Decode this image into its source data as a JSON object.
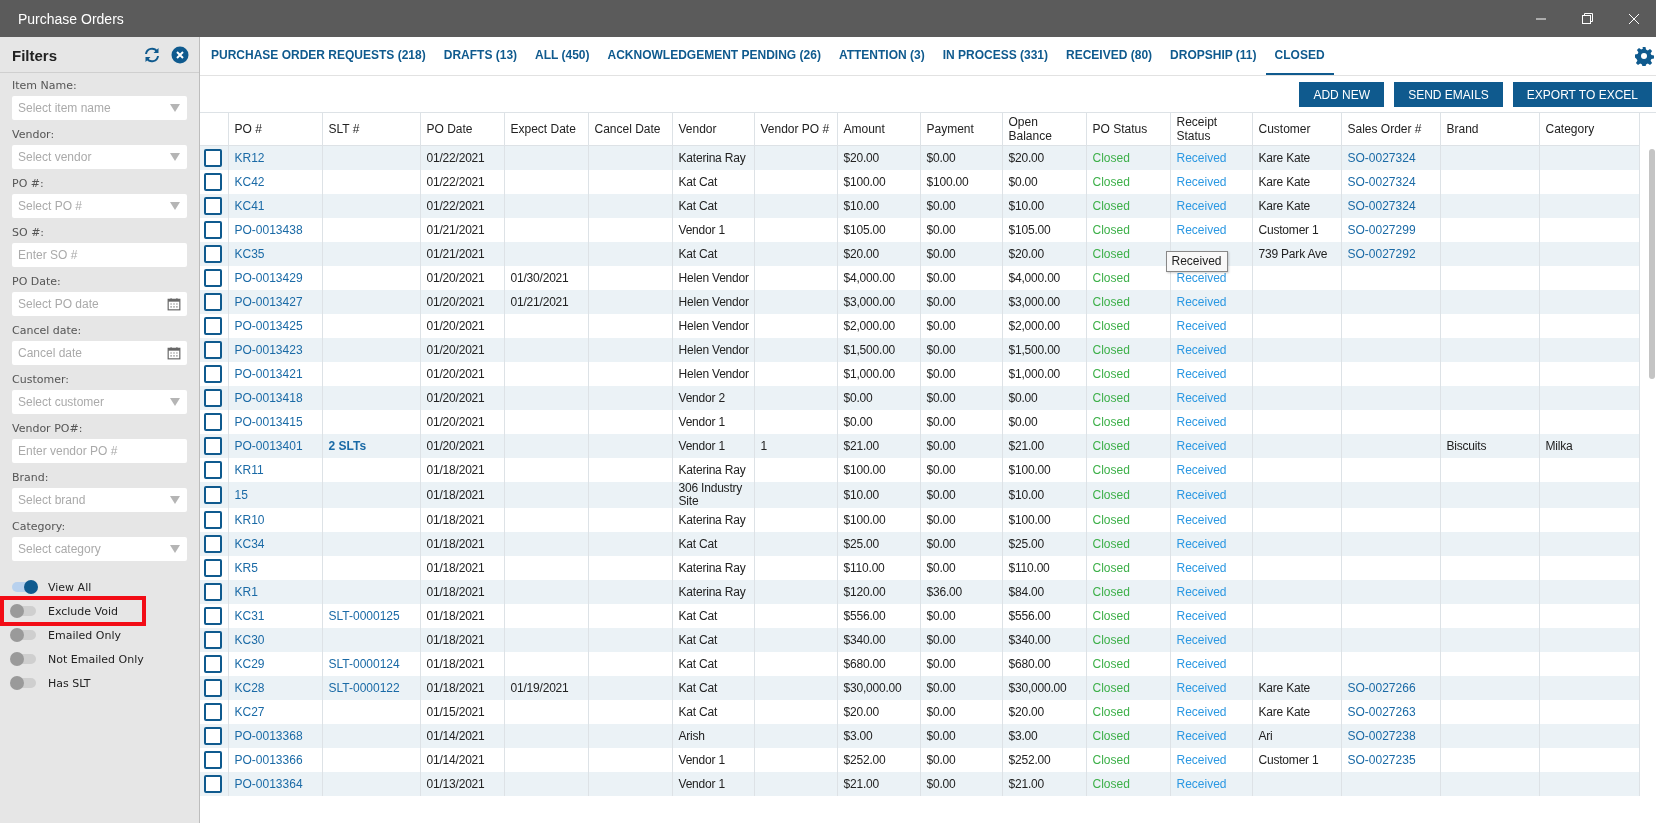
{
  "window": {
    "title": "Purchase Orders"
  },
  "filters": {
    "title": "Filters",
    "fields": [
      {
        "label": "Item Name:",
        "kind": "select",
        "placeholder": "Select item name"
      },
      {
        "label": "Vendor:",
        "kind": "select",
        "placeholder": "Select vendor"
      },
      {
        "label": "PO #:",
        "kind": "select",
        "placeholder": "Select PO #"
      },
      {
        "label": "SO #:",
        "kind": "text",
        "placeholder": "Enter SO #"
      },
      {
        "label": "PO Date:",
        "kind": "date",
        "placeholder": "Select PO date"
      },
      {
        "label": "Cancel date:",
        "kind": "date",
        "placeholder": "Cancel date"
      },
      {
        "label": "Customer:",
        "kind": "select",
        "placeholder": "Select customer"
      },
      {
        "label": "Vendor PO#:",
        "kind": "text",
        "placeholder": "Enter vendor PO #"
      },
      {
        "label": "Brand:",
        "kind": "select",
        "placeholder": "Select brand"
      },
      {
        "label": "Category:",
        "kind": "select",
        "placeholder": "Select category"
      }
    ],
    "toggles": [
      {
        "label": "View All",
        "on": true,
        "highlighted": false
      },
      {
        "label": "Exclude Void",
        "on": false,
        "highlighted": true
      },
      {
        "label": "Emailed Only",
        "on": false,
        "highlighted": false
      },
      {
        "label": "Not Emailed Only",
        "on": false,
        "highlighted": false
      },
      {
        "label": "Has SLT",
        "on": false,
        "highlighted": false
      }
    ]
  },
  "tabs": [
    {
      "label": "PURCHASE ORDER REQUESTS (218)",
      "selected": false
    },
    {
      "label": "DRAFTS (13)",
      "selected": false
    },
    {
      "label": "ALL (450)",
      "selected": false
    },
    {
      "label": "ACKNOWLEDGEMENT PENDING (26)",
      "selected": false
    },
    {
      "label": "ATTENTION (3)",
      "selected": false
    },
    {
      "label": "IN PROCESS (331)",
      "selected": false
    },
    {
      "label": "RECEIVED (80)",
      "selected": false
    },
    {
      "label": "DROPSHIP (11)",
      "selected": false
    },
    {
      "label": "CLOSED",
      "selected": true
    }
  ],
  "buttons": [
    "ADD NEW",
    "SEND EMAILS",
    "EXPORT TO EXCEL"
  ],
  "table": {
    "columns": [
      {
        "label": "PO #",
        "kind": "link"
      },
      {
        "label": "SLT #",
        "kind": "link"
      },
      {
        "label": "PO Date",
        "kind": "text"
      },
      {
        "label": "Expect Date",
        "kind": "text"
      },
      {
        "label": "Cancel Date",
        "kind": "text"
      },
      {
        "label": "Vendor",
        "kind": "text"
      },
      {
        "label": "Vendor PO #",
        "kind": "text"
      },
      {
        "label": "Amount",
        "kind": "text"
      },
      {
        "label": "Payment",
        "kind": "text"
      },
      {
        "label": "Open Balance",
        "kind": "text"
      },
      {
        "label": "PO Status",
        "kind": "status"
      },
      {
        "label": "Receipt Status",
        "kind": "receipt"
      },
      {
        "label": "Customer",
        "kind": "text"
      },
      {
        "label": "Sales Order #",
        "kind": "link"
      },
      {
        "label": "Brand",
        "kind": "text"
      },
      {
        "label": "Category",
        "kind": "text"
      }
    ],
    "rows": [
      {
        "checked": false,
        "po": "KR12",
        "po_date": "01/22/2021",
        "vendor": "Katerina Ray",
        "amount": "$20.00",
        "payment": "$0.00",
        "open_balance": "$20.00",
        "po_status": "Closed",
        "receipt_status": "Received",
        "customer": "Kare Kate",
        "sales_order": "SO-0027324"
      },
      {
        "checked": false,
        "po": "KC42",
        "po_date": "01/22/2021",
        "vendor": "Kat Cat",
        "amount": "$100.00",
        "payment": "$100.00",
        "open_balance": "$0.00",
        "po_status": "Closed",
        "receipt_status": "Received",
        "customer": "Kare Kate",
        "sales_order": "SO-0027324"
      },
      {
        "checked": false,
        "po": "KC41",
        "po_date": "01/22/2021",
        "vendor": "Kat Cat",
        "amount": "$10.00",
        "payment": "$0.00",
        "open_balance": "$10.00",
        "po_status": "Closed",
        "receipt_status": "Received",
        "customer": "Kare Kate",
        "sales_order": "SO-0027324"
      },
      {
        "checked": false,
        "po": "PO-0013438",
        "po_date": "01/21/2021",
        "vendor": "Vendor 1",
        "amount": "$105.00",
        "payment": "$0.00",
        "open_balance": "$105.00",
        "po_status": "Closed",
        "receipt_status": "Received",
        "customer": "Customer 1",
        "sales_order": "SO-0027299"
      },
      {
        "checked": false,
        "po": "KC35",
        "po_date": "01/21/2021",
        "vendor": "Kat Cat",
        "amount": "$20.00",
        "payment": "$0.00",
        "open_balance": "$20.00",
        "po_status": "Closed",
        "tooltip": "Received",
        "customer": "739 Park Ave",
        "sales_order": "SO-0027292"
      },
      {
        "checked": false,
        "po": "PO-0013429",
        "po_date": "01/20/2021",
        "expect_date": "01/30/2021",
        "vendor": "Helen Vendor",
        "amount": "$4,000.00",
        "payment": "$0.00",
        "open_balance": "$4,000.00",
        "po_status": "Closed",
        "receipt_status": "Received"
      },
      {
        "checked": false,
        "po": "PO-0013427",
        "po_date": "01/20/2021",
        "expect_date": "01/21/2021",
        "vendor": "Helen Vendor",
        "amount": "$3,000.00",
        "payment": "$0.00",
        "open_balance": "$3,000.00",
        "po_status": "Closed",
        "receipt_status": "Received"
      },
      {
        "checked": false,
        "po": "PO-0013425",
        "po_date": "01/20/2021",
        "vendor": "Helen Vendor",
        "amount": "$2,000.00",
        "payment": "$0.00",
        "open_balance": "$2,000.00",
        "po_status": "Closed",
        "receipt_status": "Received"
      },
      {
        "checked": false,
        "po": "PO-0013423",
        "po_date": "01/20/2021",
        "vendor": "Helen Vendor",
        "amount": "$1,500.00",
        "payment": "$0.00",
        "open_balance": "$1,500.00",
        "po_status": "Closed",
        "receipt_status": "Received"
      },
      {
        "checked": false,
        "po": "PO-0013421",
        "po_date": "01/20/2021",
        "vendor": "Helen Vendor",
        "amount": "$1,000.00",
        "payment": "$0.00",
        "open_balance": "$1,000.00",
        "po_status": "Closed",
        "receipt_status": "Received"
      },
      {
        "checked": false,
        "po": "PO-0013418",
        "po_date": "01/20/2021",
        "vendor": "Vendor 2",
        "amount": "$0.00",
        "payment": "$0.00",
        "open_balance": "$0.00",
        "po_status": "Closed",
        "receipt_status": "Received"
      },
      {
        "checked": false,
        "po": "PO-0013415",
        "po_date": "01/20/2021",
        "vendor": "Vendor 1",
        "amount": "$0.00",
        "payment": "$0.00",
        "open_balance": "$0.00",
        "po_status": "Closed",
        "receipt_status": "Received"
      },
      {
        "checked": false,
        "po": "PO-0013401",
        "slt": "2 SLTs",
        "slt_summary": true,
        "po_date": "01/20/2021",
        "vendor": "Vendor 1",
        "vendor_po": "1",
        "amount": "$21.00",
        "payment": "$0.00",
        "open_balance": "$21.00",
        "po_status": "Closed",
        "receipt_status": "Received",
        "brand": "Biscuits",
        "category": "Milka"
      },
      {
        "checked": false,
        "po": "KR11",
        "po_date": "01/18/2021",
        "vendor": "Katerina Ray",
        "amount": "$100.00",
        "payment": "$0.00",
        "open_balance": "$100.00",
        "po_status": "Closed",
        "receipt_status": "Received"
      },
      {
        "checked": false,
        "po": "15",
        "po_date": "01/18/2021",
        "vendor": "306 Industry Site",
        "amount": "$10.00",
        "payment": "$0.00",
        "open_balance": "$10.00",
        "po_status": "Closed",
        "receipt_status": "Received"
      },
      {
        "checked": false,
        "po": "KR10",
        "po_date": "01/18/2021",
        "vendor": "Katerina Ray",
        "amount": "$100.00",
        "payment": "$0.00",
        "open_balance": "$100.00",
        "po_status": "Closed",
        "receipt_status": "Received"
      },
      {
        "checked": false,
        "po": "KC34",
        "po_date": "01/18/2021",
        "vendor": "Kat Cat",
        "amount": "$25.00",
        "payment": "$0.00",
        "open_balance": "$25.00",
        "po_status": "Closed",
        "receipt_status": "Received"
      },
      {
        "checked": false,
        "po": "KR5",
        "po_date": "01/18/2021",
        "vendor": "Katerina Ray",
        "amount": "$110.00",
        "payment": "$0.00",
        "open_balance": "$110.00",
        "po_status": "Closed",
        "receipt_status": "Received"
      },
      {
        "checked": false,
        "po": "KR1",
        "po_date": "01/18/2021",
        "vendor": "Katerina Ray",
        "amount": "$120.00",
        "payment": "$36.00",
        "open_balance": "$84.00",
        "po_status": "Closed",
        "receipt_status": "Received"
      },
      {
        "checked": false,
        "po": "KC31",
        "slt": "SLT-0000125",
        "po_date": "01/18/2021",
        "vendor": "Kat Cat",
        "amount": "$556.00",
        "payment": "$0.00",
        "open_balance": "$556.00",
        "po_status": "Closed",
        "receipt_status": "Received"
      },
      {
        "checked": false,
        "po": "KC30",
        "po_date": "01/18/2021",
        "vendor": "Kat Cat",
        "amount": "$340.00",
        "payment": "$0.00",
        "open_balance": "$340.00",
        "po_status": "Closed",
        "receipt_status": "Received"
      },
      {
        "checked": false,
        "po": "KC29",
        "slt": "SLT-0000124",
        "po_date": "01/18/2021",
        "vendor": "Kat Cat",
        "amount": "$680.00",
        "payment": "$0.00",
        "open_balance": "$680.00",
        "po_status": "Closed",
        "receipt_status": "Received"
      },
      {
        "checked": false,
        "po": "KC28",
        "slt": "SLT-0000122",
        "po_date": "01/18/2021",
        "expect_date": "01/19/2021",
        "vendor": "Kat Cat",
        "amount": "$30,000.00",
        "payment": "$0.00",
        "open_balance": "$30,000.00",
        "po_status": "Closed",
        "receipt_status": "Received",
        "customer": "Kare Kate",
        "sales_order": "SO-0027266"
      },
      {
        "checked": false,
        "po": "KC27",
        "po_date": "01/15/2021",
        "vendor": "Kat Cat",
        "amount": "$20.00",
        "payment": "$0.00",
        "open_balance": "$20.00",
        "po_status": "Closed",
        "receipt_status": "Received",
        "customer": "Kare Kate",
        "sales_order": "SO-0027263"
      },
      {
        "checked": false,
        "po": "PO-0013368",
        "po_date": "01/14/2021",
        "vendor": "Arish",
        "amount": "$3.00",
        "payment": "$0.00",
        "open_balance": "$3.00",
        "po_status": "Closed",
        "receipt_status": "Received",
        "customer": "Ari",
        "sales_order": "SO-0027238"
      },
      {
        "checked": false,
        "po": "PO-0013366",
        "po_date": "01/14/2021",
        "vendor": "Vendor 1",
        "amount": "$252.00",
        "payment": "$0.00",
        "open_balance": "$252.00",
        "po_status": "Closed",
        "receipt_status": "Received",
        "customer": "Customer 1",
        "sales_order": "SO-0027235"
      },
      {
        "checked": false,
        "po": "PO-0013364",
        "po_date": "01/13/2021",
        "vendor": "Vendor 1",
        "amount": "$21.00",
        "payment": "$0.00",
        "open_balance": "$21.00",
        "po_status": "Closed",
        "receipt_status": "Received"
      }
    ]
  }
}
